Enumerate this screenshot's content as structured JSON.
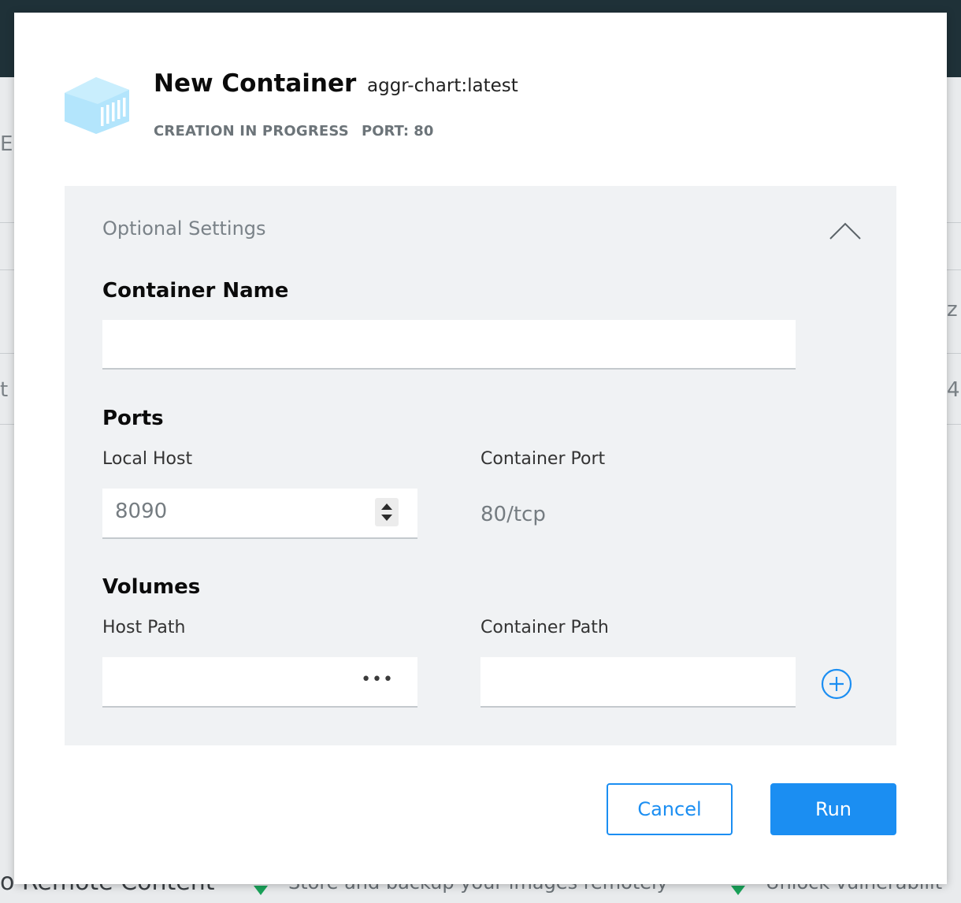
{
  "background": {
    "footer_heading": "o Remote Content",
    "footer_item_1": "Store and backup your images remotely",
    "footer_item_2": "Unlock vulnerabilit"
  },
  "modal": {
    "title": "New Container",
    "image": "aggr-chart:latest",
    "status": "CREATION IN PROGRESS",
    "port": "PORT: 80",
    "icon": "container-cube-icon"
  },
  "optional_settings": {
    "heading": "Optional Settings",
    "toggle_icon": "chevron-up-icon",
    "container_name": {
      "heading": "Container Name",
      "value": "",
      "placeholder": ""
    },
    "ports": {
      "heading": "Ports",
      "local_host_label": "Local Host",
      "container_port_label": "Container Port",
      "local_host_value": "8090",
      "container_port_value": "80/tcp"
    },
    "volumes": {
      "heading": "Volumes",
      "host_path_label": "Host Path",
      "container_path_label": "Container Path",
      "browse_label": "•••",
      "add_icon": "plus-circle-icon"
    }
  },
  "actions": {
    "cancel_label": "Cancel",
    "run_label": "Run"
  },
  "colors": {
    "accent": "#1b8ef2",
    "panel_bg": "#f0f2f4",
    "topbar": "#1f3138",
    "cube": "#b3e5fc"
  }
}
